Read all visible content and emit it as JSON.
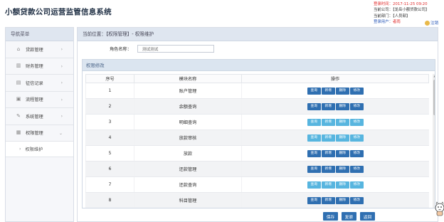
{
  "header": {
    "title": "小额贷款公司运营监管信息系统",
    "login_time_label": "登录时间：",
    "login_time_value": "2017-11-25 09:20",
    "company_label": "当前公司：",
    "company_value": "【龙岳小额贷款公司】",
    "dept_label": "当前部门：",
    "dept_value": "【人员部】",
    "user_label": "登录用户：",
    "user_value": "者雨",
    "logout_label": "注销"
  },
  "sidebar": {
    "title": "导航菜单",
    "items": [
      {
        "label": "贷款管理",
        "icon": "home-icon"
      },
      {
        "label": "财务管理",
        "icon": "bar-chart-icon"
      },
      {
        "label": "征信记录",
        "icon": "table-icon"
      },
      {
        "label": "流程管理",
        "icon": "flow-icon"
      },
      {
        "label": "系统管理",
        "icon": "wrench-icon"
      },
      {
        "label": "权限管理",
        "icon": "grid-icon"
      }
    ],
    "sub_item": "权限维护"
  },
  "breadcrumb": "当前位置：【权限管理】- 权限维护",
  "form": {
    "role_label": "角色名称：",
    "role_value": "测试测试"
  },
  "permissions": {
    "title": "权限修改",
    "columns": [
      "序号",
      "模块名称",
      "操作"
    ],
    "buttons": [
      "查询",
      "新增",
      "删除",
      "修改"
    ],
    "rows": [
      {
        "no": "1",
        "module": "账户管理",
        "active": true
      },
      {
        "no": "2",
        "module": "余额查询",
        "active": true
      },
      {
        "no": "3",
        "module": "明细查询",
        "active": false
      },
      {
        "no": "4",
        "module": "放款审核",
        "active": false
      },
      {
        "no": "5",
        "module": "放款",
        "active": true
      },
      {
        "no": "6",
        "module": "还款管理",
        "active": true
      },
      {
        "no": "7",
        "module": "还款查询",
        "active": false
      },
      {
        "no": "8",
        "module": "科目管理",
        "active": true
      }
    ]
  },
  "actions": {
    "save": "保存",
    "reset": "复原",
    "back": "返回"
  }
}
